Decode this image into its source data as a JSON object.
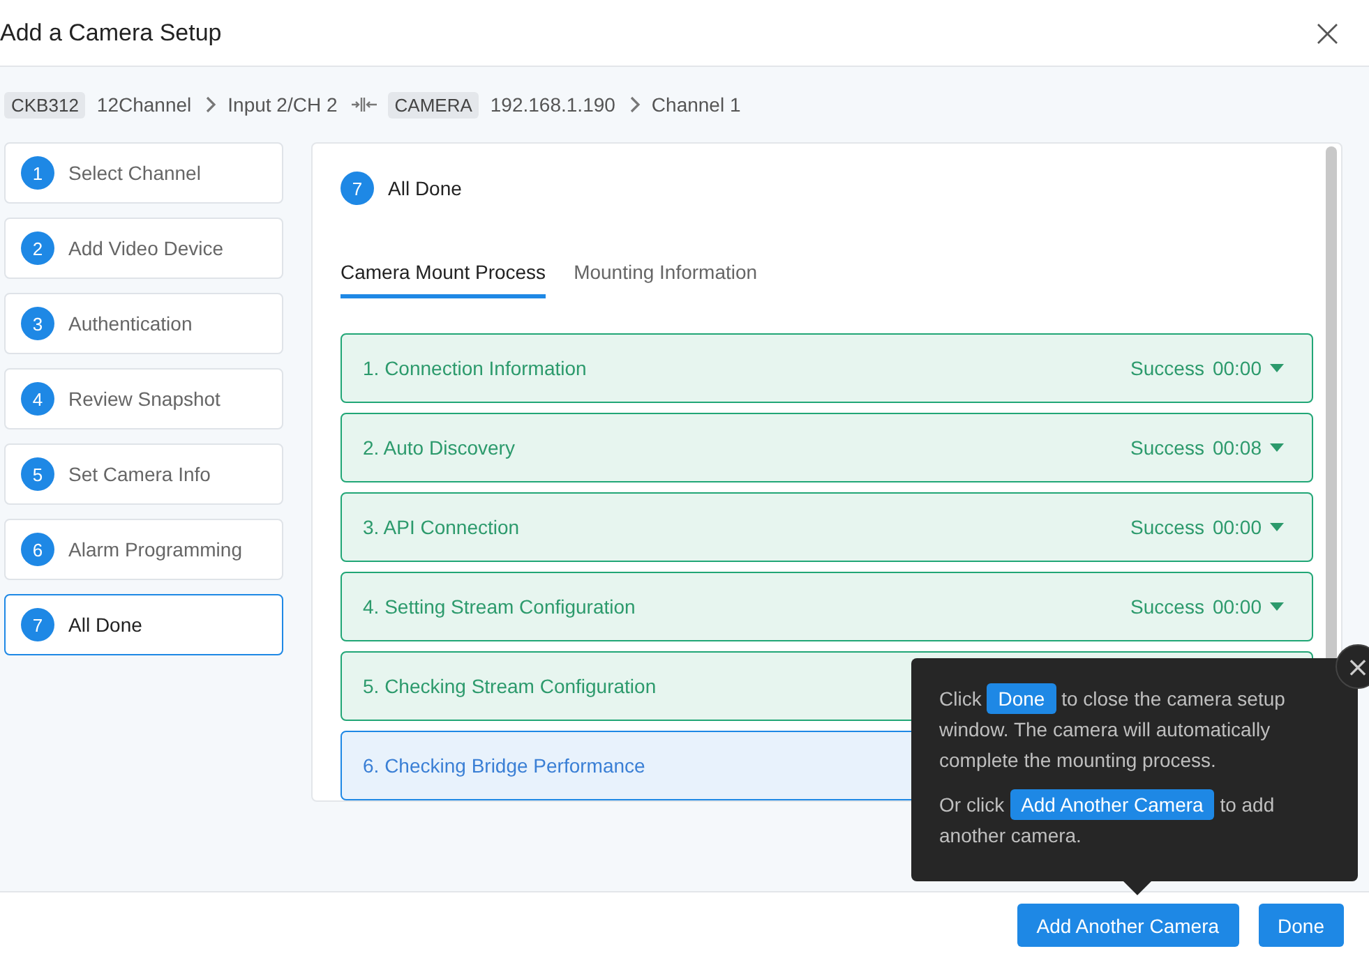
{
  "window": {
    "title": "Add a Camera Setup",
    "close": "×"
  },
  "breadcrumb": [
    {
      "kind": "tag",
      "text": "CKB312"
    },
    {
      "kind": "text",
      "text": "12Channel"
    },
    {
      "kind": "chevron"
    },
    {
      "kind": "text",
      "text": "Input 2/CH 2"
    },
    {
      "kind": "link"
    },
    {
      "kind": "tag",
      "text": "CAMERA"
    },
    {
      "kind": "text",
      "text": "192.168.1.190"
    },
    {
      "kind": "chevron"
    },
    {
      "kind": "text",
      "text": "Channel 1"
    }
  ],
  "steps": [
    {
      "number": "1",
      "label": "Select Channel",
      "selected": false
    },
    {
      "number": "2",
      "label": "Add Video Device",
      "selected": false
    },
    {
      "number": "3",
      "label": "Authentication",
      "selected": false
    },
    {
      "number": "4",
      "label": "Review Snapshot",
      "selected": false
    },
    {
      "number": "5",
      "label": "Set Camera Info",
      "selected": false
    },
    {
      "number": "6",
      "label": "Alarm Programming",
      "selected": false
    },
    {
      "number": "7",
      "label": "All Done",
      "selected": true
    }
  ],
  "panel": {
    "number": "7",
    "title": "All Done",
    "tabs": [
      {
        "label": "Camera Mount Process",
        "selected": true
      },
      {
        "label": "Mounting Information",
        "selected": false
      }
    ],
    "process": [
      {
        "label": "1. Connection Information",
        "kind": "success",
        "status": "Success",
        "time": "00:00"
      },
      {
        "label": "2. Auto Discovery",
        "kind": "success",
        "status": "Success",
        "time": "00:08"
      },
      {
        "label": "3. API Connection",
        "kind": "success",
        "status": "Success",
        "time": "00:00"
      },
      {
        "label": "4. Setting Stream Configuration",
        "kind": "success",
        "status": "Success",
        "time": "00:00"
      },
      {
        "label": "5. Checking Stream Configuration",
        "kind": "success"
      },
      {
        "label": "6. Checking Bridge Performance",
        "kind": "running"
      }
    ]
  },
  "popover": {
    "close": "×",
    "paragraphs": [
      [
        {
          "kind": "text",
          "text": "Click"
        },
        {
          "kind": "chip",
          "text": "Done"
        },
        {
          "kind": "text",
          "text": "to close the camera setup window. The camera will automatically complete the mounting process."
        }
      ],
      [
        {
          "kind": "text",
          "text": "Or click"
        },
        {
          "kind": "chip",
          "text": "Add Another Camera"
        },
        {
          "kind": "text",
          "text": "to add another camera."
        }
      ]
    ]
  },
  "footer": {
    "buttons": [
      "Add Another Camera",
      "Done"
    ]
  }
}
